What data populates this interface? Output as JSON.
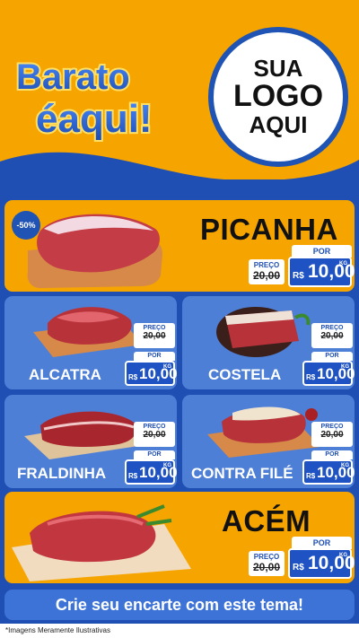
{
  "header": {
    "title_line1": "Barato",
    "title_line2": "éaqui!",
    "brand_logo": {
      "line1": "SUA",
      "line2": "LOGO",
      "line3": "AQUI"
    }
  },
  "products": [
    {
      "name": "PICANHA",
      "discount_badge": "-50%",
      "por_label": "POR",
      "preco_label": "PREÇO",
      "old_price": "20,00",
      "old_prefix": "R$",
      "currency": "R$",
      "price": "10,00",
      "unit": "KG",
      "image_icon": "meat-cut-icon"
    },
    {
      "name": "ALCATRA",
      "por_label": "POR",
      "preco_label": "PREÇO",
      "old_price": "20,00",
      "old_prefix": "R$",
      "currency": "R$",
      "price": "10,00",
      "unit": "KG",
      "image_icon": "meat-cut-icon"
    },
    {
      "name": "COSTELA",
      "por_label": "POR",
      "preco_label": "PREÇO",
      "old_price": "20,00",
      "old_prefix": "R$",
      "currency": "R$",
      "price": "10,00",
      "unit": "KG",
      "image_icon": "meat-cut-icon"
    },
    {
      "name": "FRALDINHA",
      "por_label": "POR",
      "preco_label": "PREÇO",
      "old_price": "20,00",
      "old_prefix": "R$",
      "currency": "R$",
      "price": "10,00",
      "unit": "KG",
      "image_icon": "meat-cut-icon"
    },
    {
      "name": "CONTRA FILÉ",
      "por_label": "POR",
      "preco_label": "PREÇO",
      "old_price": "20,00",
      "old_prefix": "R$",
      "currency": "R$",
      "price": "10,00",
      "unit": "KG",
      "image_icon": "meat-cut-icon"
    },
    {
      "name": "ACÉM",
      "por_label": "POR",
      "preco_label": "PREÇO",
      "old_price": "20,00",
      "old_prefix": "R$",
      "currency": "R$",
      "price": "10,00",
      "unit": "KG",
      "image_icon": "meat-cut-icon"
    }
  ],
  "cta": {
    "label": "Crie seu encarte com este tema!"
  },
  "disclaimer": "*Imagens Meramente Ilustrativas",
  "colors": {
    "orange": "#f6a500",
    "blue_dark": "#1f4fb3",
    "blue_card": "#4e7fd6",
    "price_blue": "#1f53c4"
  }
}
